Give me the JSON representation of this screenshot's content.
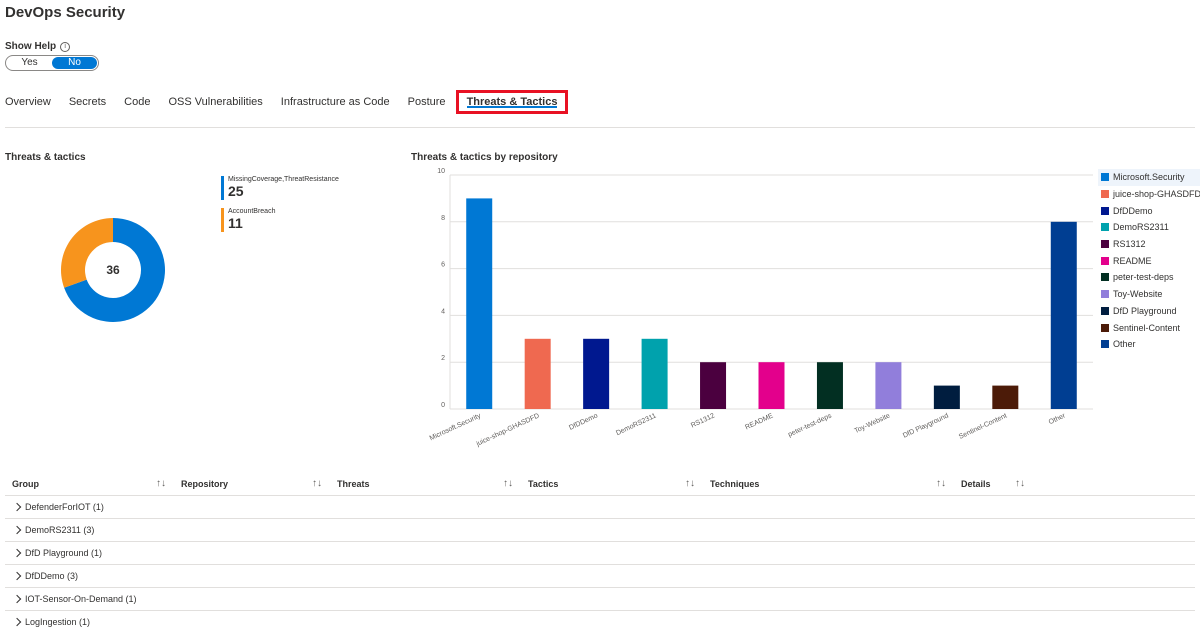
{
  "title": "DevOps Security",
  "show_help": {
    "label": "Show Help",
    "info_icon": "info-icon",
    "yes": "Yes",
    "no": "No",
    "selected": "No"
  },
  "tabs": [
    "Overview",
    "Secrets",
    "Code",
    "OSS Vulnerabilities",
    "Infrastructure as Code",
    "Posture",
    "Threats & Tactics"
  ],
  "active_tab": "Threats & Tactics",
  "left_section": {
    "title": "Threats & tactics",
    "total": "36",
    "legend": [
      {
        "name": "MissingCoverage,ThreatResistance",
        "value": "25",
        "color": "#0078d4"
      },
      {
        "name": "AccountBreach",
        "value": "11",
        "color": "#f7941d"
      }
    ]
  },
  "right_section": {
    "title": "Threats & tactics by repository"
  },
  "chart_data": [
    {
      "type": "pie",
      "title": "Threats & tactics",
      "categories": [
        "MissingCoverage,ThreatResistance",
        "AccountBreach"
      ],
      "values": [
        25,
        11
      ],
      "colors": [
        "#0078d4",
        "#f7941d"
      ]
    },
    {
      "type": "bar",
      "title": "Threats & tactics by repository",
      "categories": [
        "Microsoft.Security",
        "juice-shop-GHASDFD",
        "DfDDemo",
        "DemoRS2311",
        "RS1312",
        "README",
        "peter-test-deps",
        "Toy-Website",
        "DfD Playground",
        "Sentinel-Content",
        "Other"
      ],
      "values": [
        9,
        3,
        3,
        3,
        2,
        2,
        2,
        2,
        1,
        1,
        8
      ],
      "colors": [
        "#0078d4",
        "#ef6950",
        "#00188f",
        "#00a2ad",
        "#4b003f",
        "#e3008c",
        "#022f22",
        "#917edb",
        "#001d3f",
        "#4c1b08",
        "#003e92"
      ],
      "ylim": [
        0,
        10
      ],
      "yticks": [
        "0",
        "2",
        "4",
        "6",
        "8",
        "10"
      ],
      "grid": true,
      "legend_position": "right"
    }
  ],
  "table": {
    "columns": [
      "Group",
      "Repository",
      "Threats",
      "Tactics",
      "Techniques",
      "Details"
    ],
    "sort_icon": "sort-icon",
    "rows": [
      "DefenderForIOT (1)",
      "DemoRS2311 (3)",
      "DfD Playground (1)",
      "DfDDemo (3)",
      "IOT-Sensor-On-Demand (1)",
      "LogIngestion (1)"
    ]
  }
}
